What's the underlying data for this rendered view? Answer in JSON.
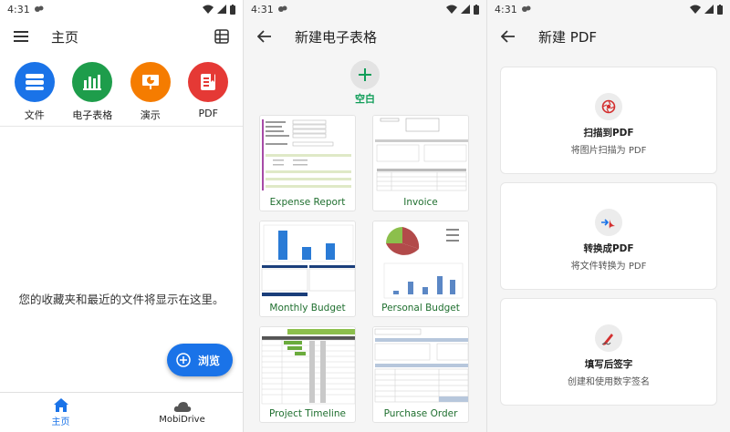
{
  "status": {
    "time": "4:31"
  },
  "home": {
    "title": "主页",
    "categories": [
      {
        "label": "文件",
        "icon": "files-icon",
        "color": "#1a73e8"
      },
      {
        "label": "电子表格",
        "icon": "spreadsheet-icon",
        "color": "#1e9d4b"
      },
      {
        "label": "演示",
        "icon": "presentation-icon",
        "color": "#f57c00"
      },
      {
        "label": "PDF",
        "icon": "pdf-icon",
        "color": "#e53935"
      }
    ],
    "empty_message": "您的收藏夹和最近的文件将显示在这里。",
    "fab_label": "浏览",
    "bottom_nav": [
      {
        "label": "主页",
        "icon": "home-icon",
        "active": true
      },
      {
        "label": "MobiDrive",
        "icon": "cloud-icon",
        "active": false
      }
    ]
  },
  "new_sheet": {
    "title": "新建电子表格",
    "blank_label": "空白",
    "templates": [
      "Expense Report",
      "Invoice",
      "Monthly Budget",
      "Personal Budget",
      "Project Timeline",
      "Purchase Order"
    ]
  },
  "new_pdf": {
    "title": "新建 PDF",
    "cards": [
      {
        "title": "扫描到PDF",
        "subtitle": "将图片扫描为 PDF",
        "icon": "scan-icon"
      },
      {
        "title": "转换成PDF",
        "subtitle": "将文件转换为 PDF",
        "icon": "convert-icon"
      },
      {
        "title": "填写后签字",
        "subtitle": "创建和使用数字签名",
        "icon": "signature-icon"
      }
    ]
  }
}
